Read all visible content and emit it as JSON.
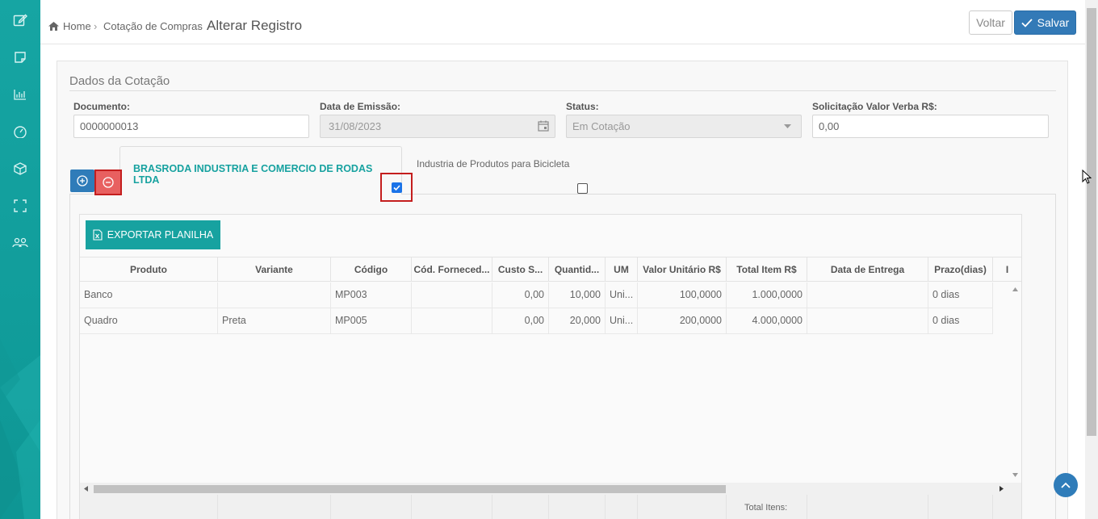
{
  "sidebar": {
    "icons": [
      "edit-icon",
      "note-icon",
      "bar-chart-icon",
      "dashboard-gauge-icon",
      "cube-icon",
      "expand-icon",
      "users-icon"
    ]
  },
  "breadcrumb": {
    "home": "Home",
    "section": "Cotação de Compras",
    "current": "Alterar Registro"
  },
  "toolbar": {
    "back_label": "Voltar",
    "save_label": "Salvar"
  },
  "panel": {
    "title": "Dados da Cotação"
  },
  "fields": {
    "documento": {
      "label": "Documento:",
      "value": "0000000013"
    },
    "data_emissao": {
      "label": "Data de Emissão:",
      "value": "31/08/2023"
    },
    "status": {
      "label": "Status:",
      "value": "Em Cotação"
    },
    "verba": {
      "label": "Solicitação Valor Verba R$:",
      "value": "0,00"
    }
  },
  "tabs": [
    {
      "label": "BRASRODA INDUSTRIA E COMERCIO DE RODAS LTDA",
      "checked": true
    },
    {
      "label": "Industria de Produtos para Bicicleta",
      "checked": false
    }
  ],
  "grid": {
    "export_label": "EXPORTAR PLANILHA",
    "columns": [
      "Produto",
      "Variante",
      "Código",
      "Cód. Forneced...",
      "Custo S...",
      "Quantid...",
      "UM",
      "Valor Unitário R$",
      "Total Item R$",
      "Data de Entrega",
      "Prazo(dias)",
      "I"
    ],
    "rows": [
      [
        "Banco",
        "",
        "MP003",
        "",
        "0,00",
        "10,000",
        "Uni...",
        "100,0000",
        "1.000,0000",
        "",
        "0 dias"
      ],
      [
        "Quadro",
        "Preta",
        "MP005",
        "",
        "0,00",
        "20,000",
        "Uni...",
        "200,0000",
        "4.000,0000",
        "",
        "0 dias"
      ]
    ],
    "footer_label": "Total Itens:"
  },
  "colors": {
    "sidebar": "#16a5a3",
    "accent_teal": "#17a2a0",
    "primary_blue": "#337ab7",
    "danger_red": "#c41e1e"
  }
}
